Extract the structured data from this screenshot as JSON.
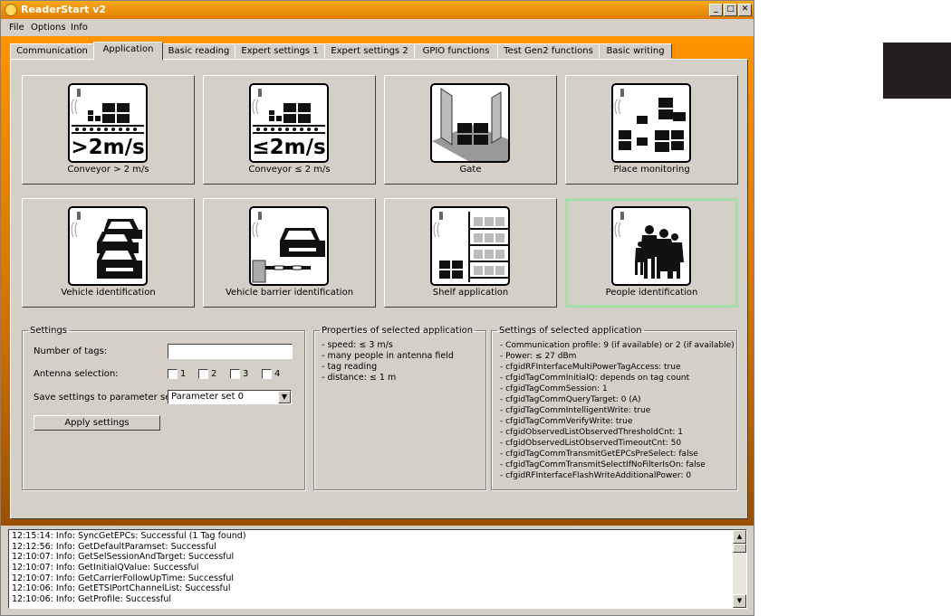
{
  "window": {
    "title": "ReaderStart v2"
  },
  "menu": [
    "File",
    "Options",
    "Info"
  ],
  "tabs": [
    "Communication",
    "Application",
    "Basic reading",
    "Expert settings 1",
    "Expert settings 2",
    "GPIO functions",
    "Test Gen2 functions",
    "Basic writing"
  ],
  "active_tab": "Application",
  "applications": [
    {
      "label": "Conveyor > 2 m/s",
      "icon": "conveyor-fast-icon",
      "badge": ">2m/s"
    },
    {
      "label": "Conveyor ≤ 2 m/s",
      "icon": "conveyor-slow-icon",
      "badge": "≤2m/s"
    },
    {
      "label": "Gate",
      "icon": "gate-icon"
    },
    {
      "label": "Place monitoring",
      "icon": "place-monitoring-icon"
    },
    {
      "label": "Vehicle identification",
      "icon": "vehicle-icon"
    },
    {
      "label": "Vehicle barrier identification",
      "icon": "vehicle-barrier-icon"
    },
    {
      "label": "Shelf application",
      "icon": "shelf-icon"
    },
    {
      "label": "People identification",
      "icon": "people-icon"
    }
  ],
  "selected_application": "People identification",
  "settings": {
    "legend": "Settings",
    "number_of_tags_label": "Number of tags:",
    "number_of_tags_value": "",
    "antenna_label": "Antenna selection:",
    "antennas": [
      "1",
      "2",
      "3",
      "4"
    ],
    "save_label": "Save settings to parameter set:",
    "parameter_set": "Parameter set 0",
    "apply_button": "Apply settings"
  },
  "properties": {
    "legend": "Properties of selected application",
    "lines": [
      "- speed: ≤ 3 m/s",
      "- many people in antenna field",
      "- tag reading",
      "- distance: ≤ 1 m"
    ]
  },
  "selected_settings": {
    "legend": "Settings of selected application",
    "lines": [
      "- Communication profile: 9 (if available) or 2 (if available)",
      "- Power: ≤ 27 dBm",
      "- cfgidRFInterfaceMultiPowerTagAccess: true",
      "- cfgidTagCommInitialQ: depends on tag count",
      "- cfgidTagCommSession: 1",
      "- cfgidTagCommQueryTarget: 0 (A)",
      "- cfgidTagCommIntelligentWrite: true",
      "- cfgidTagCommVerifyWrite: true",
      "- cfgidObservedListObservedThresholdCnt: 1",
      "- cfgidObservedListObservedTimeoutCnt: 50",
      "- cfgidTagCommTransmitGetEPCsPreSelect: false",
      "- cfgidTagCommTransmitSelectIfNoFilterIsOn: false",
      "- cfgidRFInterfaceFlashWriteAdditionalPower: 0"
    ]
  },
  "log": [
    "12:15:14: Info: SyncGetEPCs: Successful (1 Tag found)",
    "12:12:56: Info: GetDefaultParamset: Successful",
    "12:10:07: Info: GetSelSessionAndTarget: Successful",
    "12:10:07: Info: GetInitialQValue: Successful",
    "12:10:07: Info: GetCarrierFollowUpTime: Successful",
    "12:10:06: Info: GetETSIPortChannelList: Successful",
    "12:10:06: Info: GetProfile: Successful"
  ],
  "colors": {
    "accent": "#ff9400",
    "selected_border": "#a8dca8",
    "face": "#d4d0c8"
  }
}
